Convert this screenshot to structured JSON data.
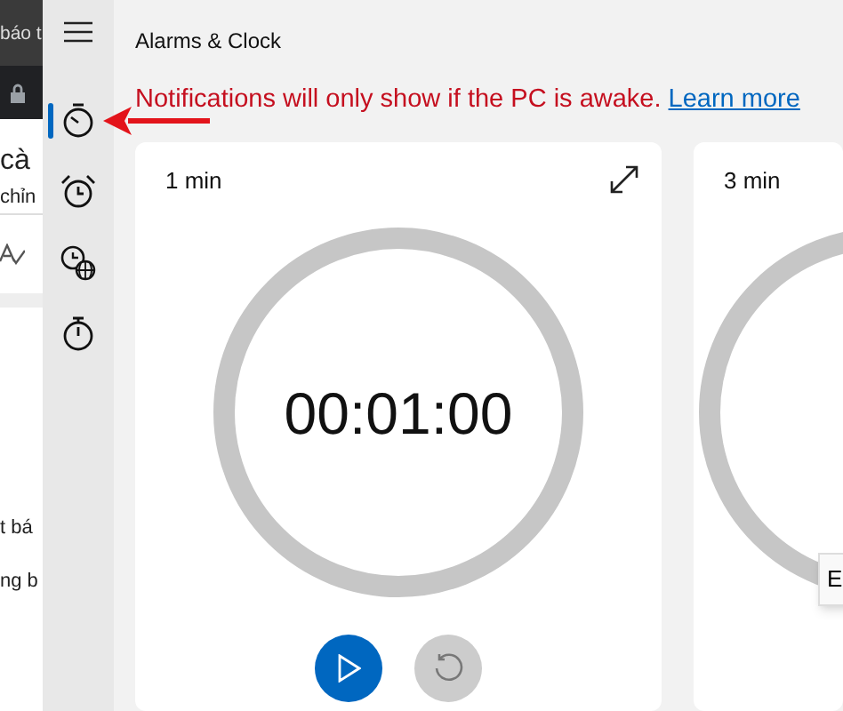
{
  "background_browser": {
    "tab_text": "báo t",
    "lines": [
      {
        "text": "cà",
        "kind": "heading"
      },
      {
        "text": "chỉn",
        "kind": "sub"
      },
      {
        "text": "t bá",
        "kind": "body"
      },
      {
        "text": "ng b",
        "kind": "body"
      }
    ]
  },
  "sidebar": {
    "items": [
      {
        "kind": "timer",
        "selected": true
      },
      {
        "kind": "alarm",
        "selected": false
      },
      {
        "kind": "world",
        "selected": false
      },
      {
        "kind": "stopwatch",
        "selected": false
      }
    ]
  },
  "window": {
    "title": "Alarms & Clock"
  },
  "notice": {
    "text": "Notifications will only show if the PC is awake.",
    "link": "Learn more"
  },
  "timers": [
    {
      "label": "1 min",
      "time": "00:01:00",
      "level": 1
    },
    {
      "label": "3 min"
    }
  ],
  "tooltip": "E"
}
